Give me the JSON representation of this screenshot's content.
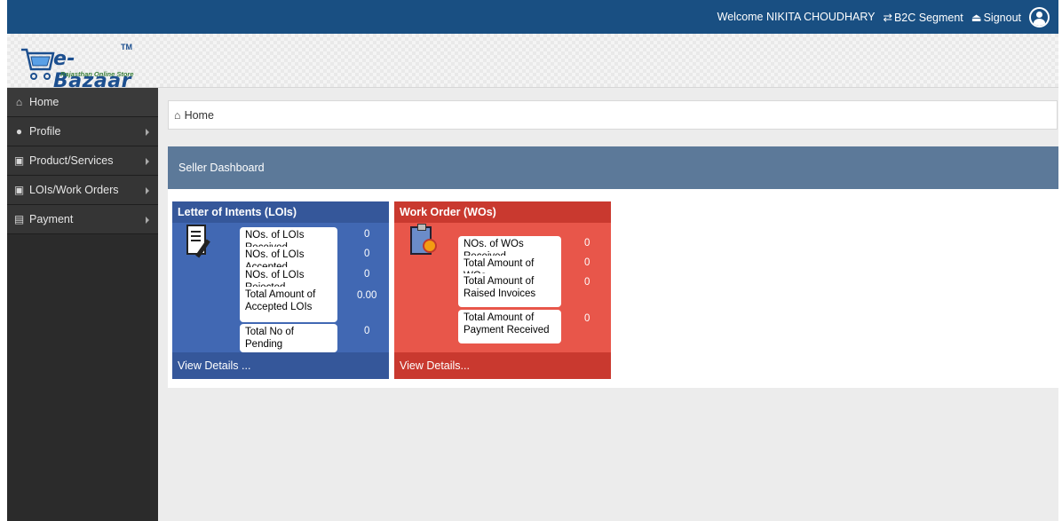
{
  "header": {
    "welcome": "Welcome NIKITA CHOUDHARY",
    "segment": "B2C Segment",
    "signout": "Signout"
  },
  "logo": {
    "name": "e-Bazaar",
    "tm": "TM",
    "subtitle": "Rajasthan Online Store"
  },
  "sidebar": {
    "items": [
      {
        "label": "Home",
        "icon": "home-icon"
      },
      {
        "label": "Profile",
        "icon": "user-icon"
      },
      {
        "label": "Product/Services",
        "icon": "products-icon"
      },
      {
        "label": "LOIs/Work Orders",
        "icon": "orders-icon"
      },
      {
        "label": "Payment",
        "icon": "money-icon"
      }
    ]
  },
  "breadcrumb": {
    "label": "Home"
  },
  "dashboard": {
    "title": "Seller Dashboard",
    "loi": {
      "title": "Letter of Intents (LOIs)",
      "rows": [
        {
          "label": "NOs. of LOIs Received",
          "value": "0"
        },
        {
          "label": "NOs. of LOIs Accepted",
          "value": "0"
        },
        {
          "label": "NOs. of LOIs Rejected",
          "value": "0"
        },
        {
          "label": "Total Amount of Accepted LOIs",
          "value": "0.00"
        },
        {
          "label": "Total No of Pending",
          "value": "0"
        }
      ],
      "footer": "View Details ..."
    },
    "wo": {
      "title": "Work Order (WOs)",
      "rows": [
        {
          "label": "NOs. of WOs Received",
          "value": "0"
        },
        {
          "label": "Total Amount of WOs",
          "value": "0"
        },
        {
          "label": "Total Amount of Raised Invoices",
          "value": "0"
        },
        {
          "label": "Total Amount of Payment Received",
          "value": "0"
        }
      ],
      "footer": "View Details..."
    }
  },
  "colors": {
    "topbar": "#194f82",
    "loi_card": "#4168b3",
    "loi_card_dark": "#35579a",
    "wo_card": "#e8564a",
    "wo_card_dark": "#c9392f"
  }
}
